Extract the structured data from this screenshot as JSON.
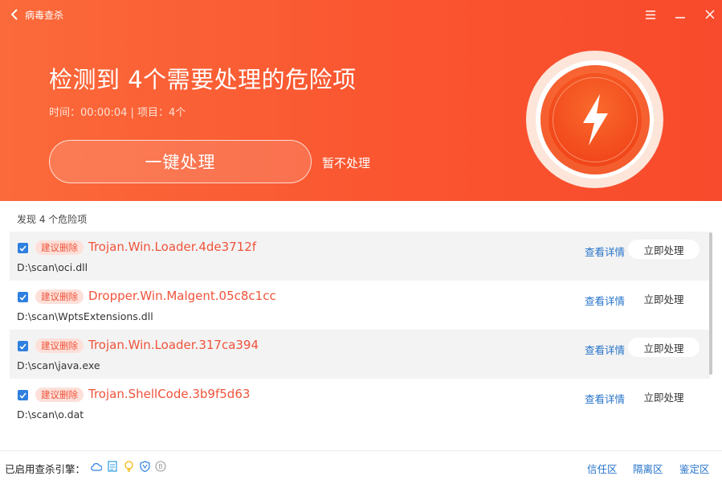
{
  "window": {
    "title": "病毒查杀",
    "back_icon": "chevron-left-icon",
    "controls": [
      "menu-icon",
      "minimize-icon",
      "close-icon"
    ]
  },
  "summary": {
    "headline": "检测到 4个需要处理的危险项",
    "meta": "时间：00:00:04 | 项目：4个",
    "primary_action": "一键处理",
    "secondary_action": "暂不处理",
    "badge_icon": "lightning-icon"
  },
  "list": {
    "found_label": "发现 4 个危险项",
    "items": [
      {
        "checked": true,
        "tag": "建议删除",
        "threat": "Trojan.Win.Loader.4de3712f",
        "path": "D:\\scan\\oci.dll",
        "details": "查看详情",
        "action": "立即处理"
      },
      {
        "checked": true,
        "tag": "建议删除",
        "threat": "Dropper.Win.Malgent.05c8c1cc",
        "path": "D:\\scan\\WptsExtensions.dll",
        "details": "查看详情",
        "action": "立即处理"
      },
      {
        "checked": true,
        "tag": "建议删除",
        "threat": "Trojan.Win.Loader.317ca394",
        "path": "D:\\scan\\java.exe",
        "details": "查看详情",
        "action": "立即处理"
      },
      {
        "checked": true,
        "tag": "建议删除",
        "threat": "Trojan.ShellCode.3b9f5d63",
        "path": "D:\\scan\\o.dat",
        "details": "查看详情",
        "action": "立即处理"
      }
    ]
  },
  "footer": {
    "protection_text": "已启用查杀引擎：",
    "engine_icons": [
      "cloud-icon",
      "document-scan-icon",
      "bulb-icon",
      "shield-icon",
      "b-engine-icon"
    ],
    "links": {
      "trust": "信任区",
      "quarantine": "隔离区",
      "appraise": "鉴定区"
    }
  },
  "colors": {
    "header_start": "#fb6a3a",
    "header_end": "#f84a2c",
    "danger_text": "#f0533a",
    "link": "#2673c9",
    "checkbox": "#2d7fe0"
  }
}
